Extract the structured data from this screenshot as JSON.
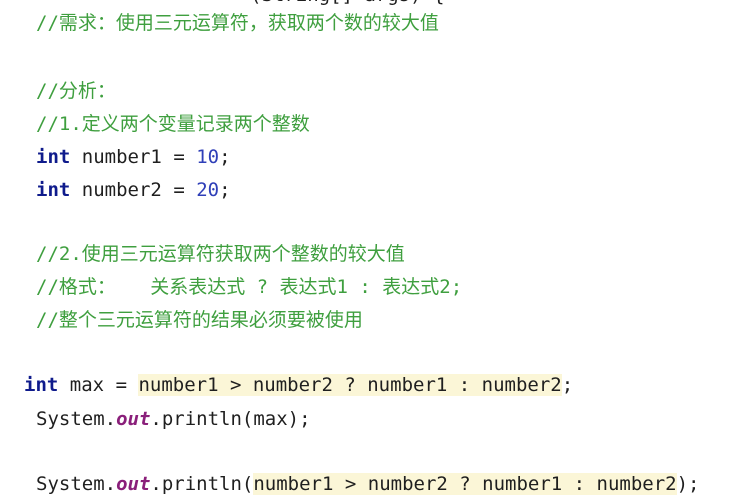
{
  "lines": {
    "partial_top": "(String[] args) {",
    "c1": "//需求：使用三元运算符，获取两个数的较大值",
    "c2": "//分析：",
    "c3": "//1.定义两个变量记录两个整数",
    "l1_kw": "int",
    "l1_name": "number1",
    "l1_eq": "=",
    "l1_val": "10",
    "l1_semi": ";",
    "l2_kw": "int",
    "l2_name": "number2",
    "l2_eq": "=",
    "l2_val": "20",
    "l2_semi": ";",
    "c4": "//2.使用三元运算符获取两个整数的较大值",
    "c5": "//格式：   关系表达式 ? 表达式1 : 表达式2;",
    "c6": "//整个三元运算符的结果必须要被使用",
    "l3_kw": "int",
    "l3_name": "max",
    "l3_eq": "=",
    "l3_expr": "number1 > number2 ? number1 : number2",
    "l3_semi": ";",
    "l4_system": "System.",
    "l4_out": "out",
    "l4_rest": ".println(max);",
    "l5_system": "System.",
    "l5_out": "out",
    "l5_open": ".println(",
    "l5_expr": "number1 > number2 ? number1 : number2",
    "l5_close": ");"
  },
  "colors": {
    "comment": "#3f9f3f",
    "keyword": "#0f1b8c",
    "number": "#2f3fb8",
    "static_field": "#8a1f7a",
    "highlight": "#fbf6d7"
  }
}
